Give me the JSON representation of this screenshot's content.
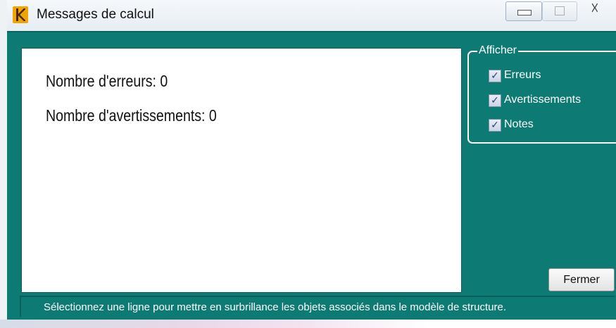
{
  "window": {
    "title": "Messages de calcul",
    "app_icon": "k-app-icon"
  },
  "title_buttons": {
    "minimize_icon": "minimize-icon",
    "maximize_icon": "maximize-icon",
    "close_glyph": "☓"
  },
  "messages": {
    "errors_line": "Nombre d'erreurs: 0",
    "warnings_line": "Nombre d'avertissements: 0"
  },
  "filter": {
    "legend": "Afficher",
    "options": [
      {
        "label": "Erreurs",
        "checked": true
      },
      {
        "label": "Avertissements",
        "checked": true
      },
      {
        "label": "Notes",
        "checked": true
      }
    ],
    "check_glyph": "✓"
  },
  "actions": {
    "close_label": "Fermer"
  },
  "status": {
    "hint": "Sélectionnez une ligne pour mettre en surbrillance les objets associés dans le modèle de structure."
  },
  "colors": {
    "panel_background": "#0d7b73",
    "pane_background": "#ffffff"
  }
}
